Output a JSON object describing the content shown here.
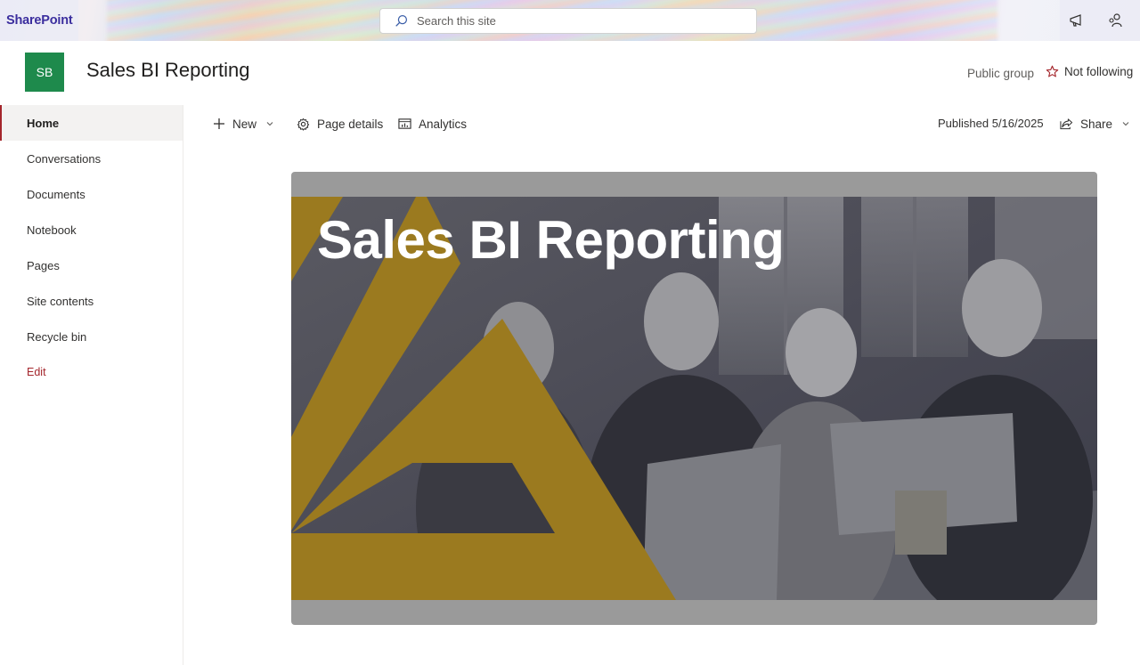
{
  "suite": {
    "brand": "SharePoint",
    "search_placeholder": "Search this site",
    "icons": [
      "search-icon",
      "announcement-icon",
      "settings-people-icon"
    ]
  },
  "site": {
    "logo_initials": "SB",
    "title": "Sales BI Reporting",
    "group_type": "Public group",
    "follow_label": "Not following",
    "colors": {
      "logo_bg": "#1e8a4c",
      "accent": "#a4262c",
      "hero_gold": "#9b7a1f"
    }
  },
  "nav": {
    "items": [
      {
        "label": "Home",
        "active": true
      },
      {
        "label": "Conversations"
      },
      {
        "label": "Documents"
      },
      {
        "label": "Notebook"
      },
      {
        "label": "Pages"
      },
      {
        "label": "Site contents"
      },
      {
        "label": "Recycle bin"
      }
    ],
    "edit_label": "Edit"
  },
  "commandbar": {
    "new_label": "New",
    "page_details_label": "Page details",
    "analytics_label": "Analytics",
    "published": "Published 5/16/2025",
    "share_label": "Share"
  },
  "hero": {
    "title": "Sales BI Reporting"
  }
}
